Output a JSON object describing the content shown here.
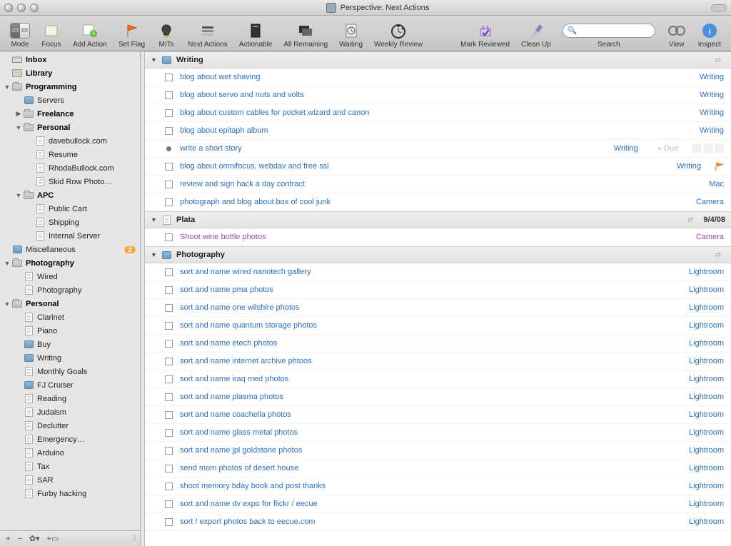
{
  "window_title": "Perspective: Next Actions",
  "toolbar": {
    "mode": "Mode",
    "focus": "Focus",
    "add_action": "Add Action",
    "set_flag": "Set Flag",
    "mits": "MITs",
    "next_actions": "Next Actions",
    "actionable": "Actionable",
    "all_remaining": "All Remaining",
    "waiting": "Waiting",
    "weekly_review": "Weekly Review",
    "mark_reviewed": "Mark Reviewed",
    "clean_up": "Clean Up",
    "search": "Search",
    "view": "View",
    "inspect": "Inspect",
    "search_placeholder": ""
  },
  "sidebar": {
    "inbox": "Inbox",
    "library": "Library",
    "programming": {
      "label": "Programming",
      "servers": "Servers",
      "freelance": "Freelance",
      "personal": {
        "label": "Personal",
        "items": [
          "davebullock.com",
          "Resume",
          "RhodaBullock.com",
          "Skid Row Photo…"
        ]
      },
      "apc": {
        "label": "APC",
        "items": [
          "Public Cart",
          "Shipping",
          "Internal Server"
        ]
      }
    },
    "miscellaneous": {
      "label": "Miscellaneous",
      "badge": "2"
    },
    "photography": {
      "label": "Photography",
      "items": [
        "Wired",
        "Photography"
      ]
    },
    "personal": {
      "label": "Personal",
      "items": [
        "Clarinet",
        "Piano",
        "Buy",
        "Writing",
        "Monthly Goals",
        "FJ Cruiser",
        "Reading",
        "Judaism",
        "Declutter",
        "Emergency…",
        "Arduino",
        "Tax",
        "SAR",
        "Furby hacking"
      ]
    }
  },
  "groups": [
    {
      "name": "Writing",
      "icon": "box",
      "date": "",
      "tasks": [
        {
          "title": "blog about wet shaving",
          "ctx": "Writing"
        },
        {
          "title": "blog about servo and nuts and volts",
          "ctx": "Writing"
        },
        {
          "title": "blog about custom cables for pocket wizard and canon",
          "ctx": "Writing"
        },
        {
          "title": "blog about epitaph album",
          "ctx": "Writing"
        },
        {
          "title": "write a short story",
          "ctx": "Writing",
          "bullet": true,
          "due": "Due",
          "icons": true
        },
        {
          "title": "blog about omnifocus, webdav and free ssl",
          "ctx": "Writing",
          "flag": true
        },
        {
          "title": "review and sign hack a day contract",
          "ctx": "Mac"
        },
        {
          "title": "photograph and blog about box of cool junk",
          "ctx": "Camera"
        }
      ]
    },
    {
      "name": "Plata",
      "icon": "page",
      "date": "9/4/08",
      "tasks": [
        {
          "title": "Shoot wine bottle photos",
          "ctx": "Camera",
          "purple": true
        }
      ]
    },
    {
      "name": "Photography",
      "icon": "box",
      "date": "",
      "tasks": [
        {
          "title": "sort and name wired nanotech gallery",
          "ctx": "Lightroom"
        },
        {
          "title": "sort and name pma photos",
          "ctx": "Lightroom"
        },
        {
          "title": "sort and name one wilshire photos",
          "ctx": "Lightroom"
        },
        {
          "title": "sort and name quantum storage photos",
          "ctx": "Lightroom"
        },
        {
          "title": "sort and name etech photos",
          "ctx": "Lightroom"
        },
        {
          "title": "sort and name internet archive phtoos",
          "ctx": "Lightroom"
        },
        {
          "title": "sort and name iraq med photos",
          "ctx": "Lightroom"
        },
        {
          "title": "sort and name plasma photos",
          "ctx": "Lightroom"
        },
        {
          "title": "sort and name coachella photos",
          "ctx": "Lightroom"
        },
        {
          "title": "sort and name glass metal photos",
          "ctx": "Lightroom"
        },
        {
          "title": "sort and name jpl goldstone photos",
          "ctx": "Lightroom"
        },
        {
          "title": "send mom photos of desert house",
          "ctx": "Lightroom"
        },
        {
          "title": "shoot memory bday book and post thanks",
          "ctx": "Lightroom"
        },
        {
          "title": "sort and name dv expo for flickr / eecue",
          "ctx": "Lightroom"
        },
        {
          "title": "sort / export photos back to eecue.com",
          "ctx": "Lightroom"
        }
      ]
    }
  ]
}
